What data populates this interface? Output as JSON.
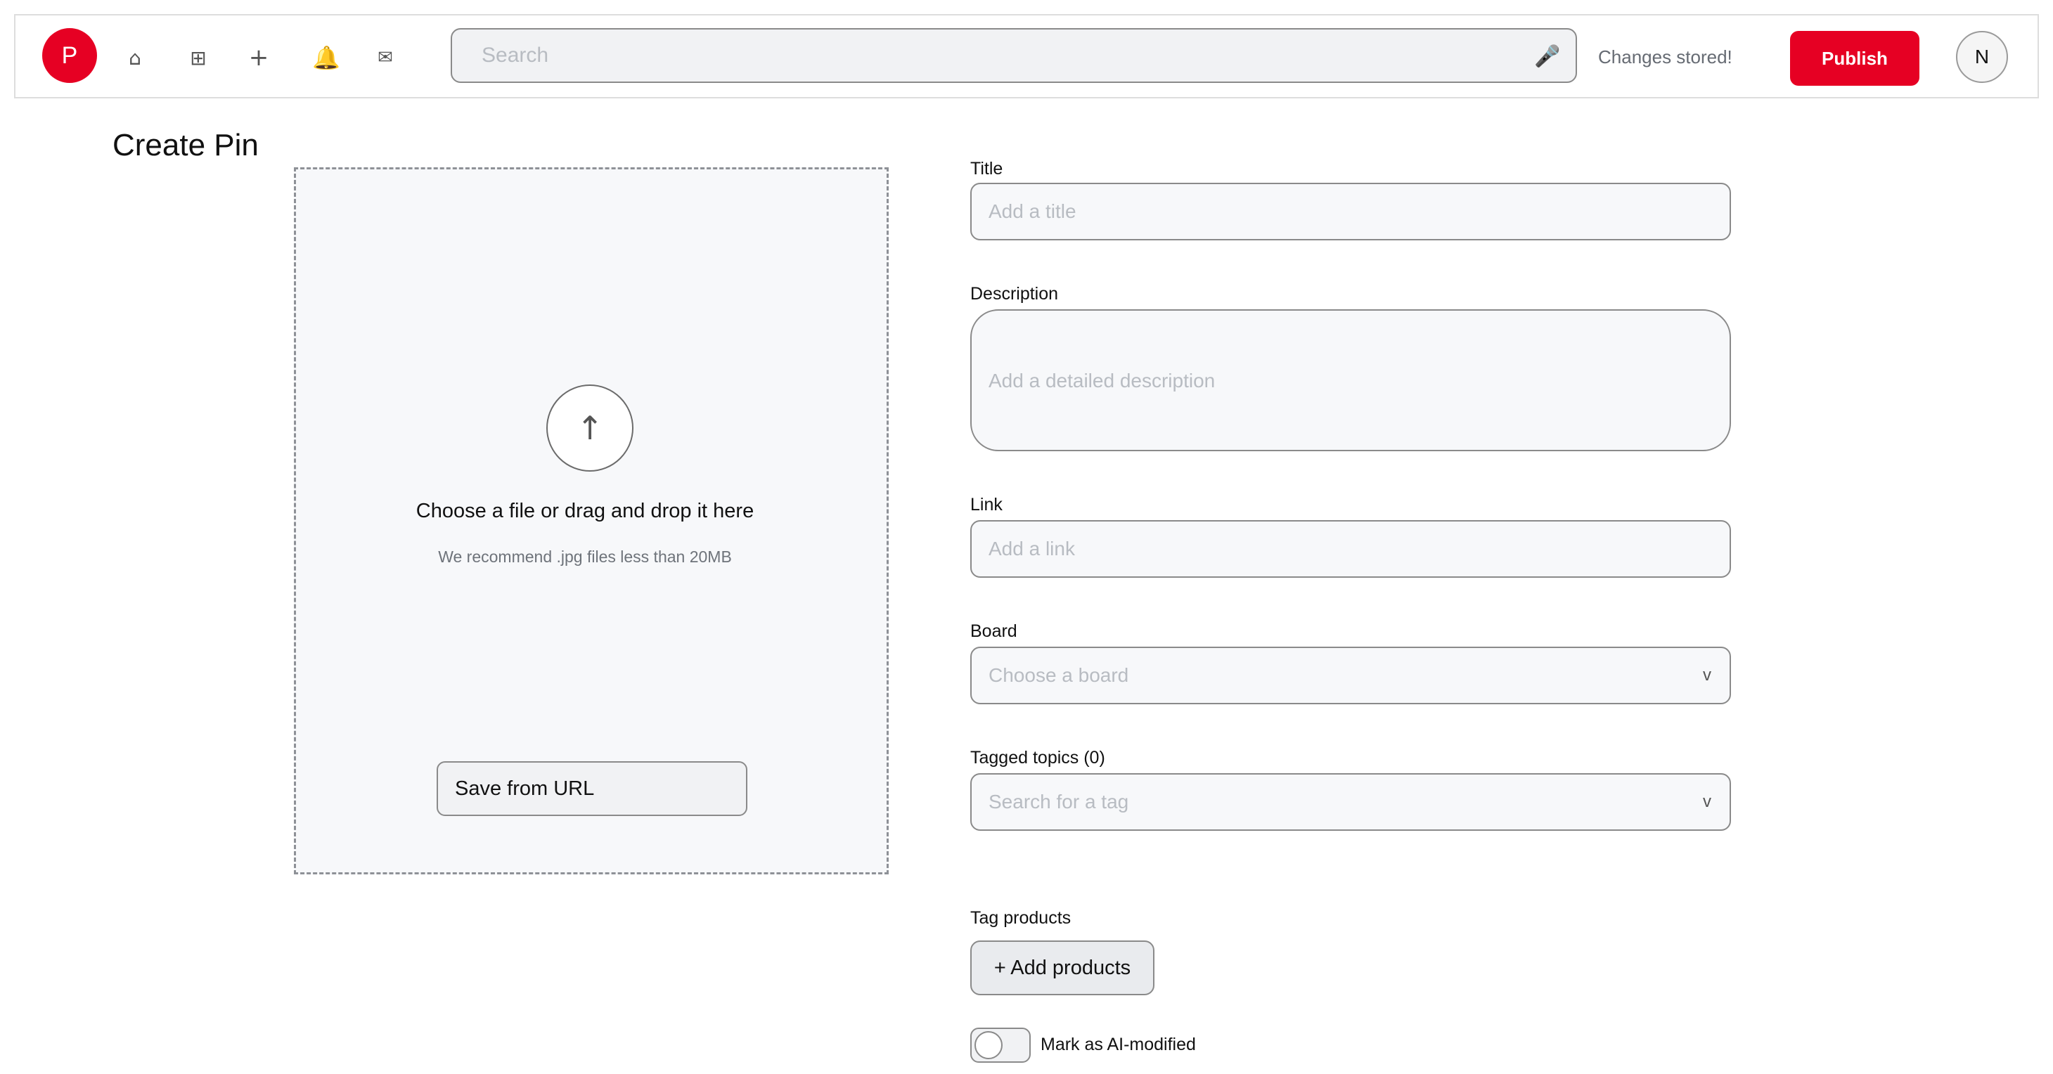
{
  "app": {
    "logo_letter": "P",
    "brand_color": "#e60023"
  },
  "nav": {
    "icons": [
      "home-icon",
      "grid-icon",
      "plus-icon",
      "bell-icon",
      "mail-icon"
    ]
  },
  "search": {
    "placeholder": "Search",
    "value": "",
    "mic_icon": "microphone-icon"
  },
  "header": {
    "status": "Changes stored!",
    "publish_label": "Publish",
    "avatar_initial": "N"
  },
  "page": {
    "title": "Create Pin"
  },
  "upload": {
    "icon": "upload-arrow-icon",
    "main_text": "Choose a file or drag and drop it here",
    "sub_text": "We recommend .jpg files less than 20MB",
    "save_url_label": "Save from URL"
  },
  "form": {
    "title": {
      "label": "Title",
      "placeholder": "Add a title",
      "value": ""
    },
    "description": {
      "label": "Description",
      "placeholder": "Add a detailed description",
      "value": ""
    },
    "link": {
      "label": "Link",
      "placeholder": "Add a link",
      "value": ""
    },
    "board": {
      "label": "Board",
      "placeholder": "Choose a board",
      "chevron": "v"
    },
    "tagged_topics": {
      "label": "Tagged topics (0)",
      "placeholder": "Search for a tag",
      "chevron": "v"
    },
    "tag_products": {
      "label": "Tag products",
      "button_label": "+ Add products"
    },
    "ai_modified": {
      "label": "Mark as AI-modified",
      "checked": false
    }
  }
}
